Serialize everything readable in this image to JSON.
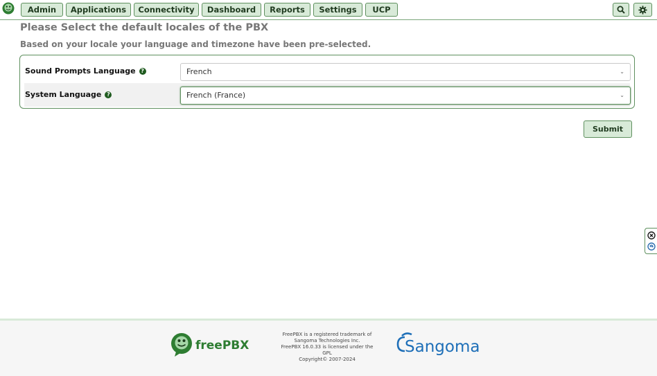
{
  "nav": {
    "items": [
      {
        "label": "Admin"
      },
      {
        "label": "Applications"
      },
      {
        "label": "Connectivity"
      },
      {
        "label": "Dashboard"
      },
      {
        "label": "Reports"
      },
      {
        "label": "Settings"
      },
      {
        "label": "UCP"
      }
    ],
    "icons": [
      "search-icon",
      "gear-icon"
    ]
  },
  "page": {
    "title": "Please Select the default locales of the PBX",
    "subtitle": "Based on your locale your language and timezone have been pre-selected."
  },
  "form": {
    "sound_prompts": {
      "label": "Sound Prompts Language",
      "value": "French"
    },
    "system_language": {
      "label": "System Language",
      "value": "French (France)"
    }
  },
  "submit_label": "Submit",
  "footer": {
    "brand": "freePBX",
    "trademark_lines": [
      "FreePBX is a registered trademark of",
      "Sangoma Technologies Inc.",
      "FreePBX 16.0.33 is licensed under the",
      "GPL",
      "Copyright© 2007-2024"
    ],
    "partner": "Sangoma"
  },
  "colors": {
    "accent": "#5e8f5e",
    "button_bg": "#d8ead8"
  }
}
